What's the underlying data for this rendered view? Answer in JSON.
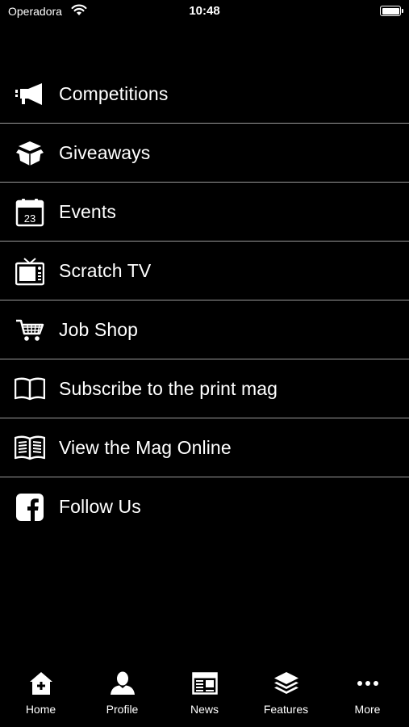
{
  "status_bar": {
    "carrier": "Operadora",
    "time": "10:48"
  },
  "menu": [
    {
      "label": "Competitions",
      "icon": "megaphone-icon"
    },
    {
      "label": "Giveaways",
      "icon": "open-box-icon"
    },
    {
      "label": "Events",
      "icon": "calendar-icon",
      "icon_text": "23"
    },
    {
      "label": "Scratch TV",
      "icon": "tv-icon"
    },
    {
      "label": "Job Shop",
      "icon": "shopping-cart-icon"
    },
    {
      "label": "Subscribe to the print mag",
      "icon": "open-book-icon"
    },
    {
      "label": "View the Mag Online",
      "icon": "magazine-icon"
    },
    {
      "label": "Follow Us",
      "icon": "facebook-icon"
    }
  ],
  "tab_bar": [
    {
      "label": "Home",
      "icon": "home-icon"
    },
    {
      "label": "Profile",
      "icon": "user-icon"
    },
    {
      "label": "News",
      "icon": "newspaper-icon"
    },
    {
      "label": "Features",
      "icon": "layers-icon"
    },
    {
      "label": "More",
      "icon": "more-dots-icon"
    }
  ],
  "colors": {
    "background": "#000000",
    "text": "#ffffff",
    "divider": "#9a9a9a"
  }
}
